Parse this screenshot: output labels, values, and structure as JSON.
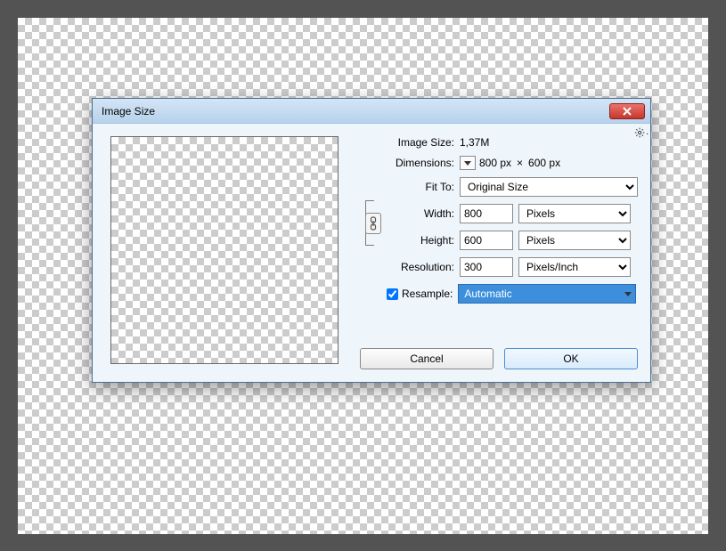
{
  "dialog": {
    "title": "Image Size",
    "imageSize": {
      "label": "Image Size:",
      "value": "1,37M"
    },
    "dimensions": {
      "label": "Dimensions:",
      "w": "800 px",
      "sep": "×",
      "h": "600 px"
    },
    "fitTo": {
      "label": "Fit To:",
      "value": "Original Size"
    },
    "width": {
      "label": "Width:",
      "value": "800",
      "unit": "Pixels"
    },
    "height": {
      "label": "Height:",
      "value": "600",
      "unit": "Pixels"
    },
    "resolution": {
      "label": "Resolution:",
      "value": "300",
      "unit": "Pixels/Inch"
    },
    "resample": {
      "label": "Resample:",
      "checked": true,
      "method": "Automatic"
    },
    "buttons": {
      "cancel": "Cancel",
      "ok": "OK"
    }
  }
}
